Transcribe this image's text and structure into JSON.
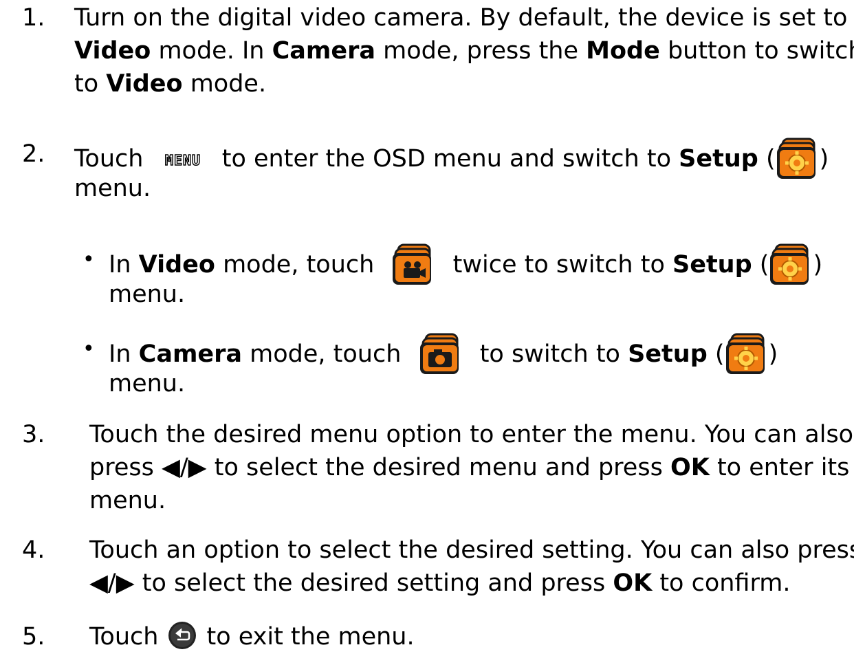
{
  "steps": [
    {
      "number": "1.",
      "lines": [
        [
          "Turn on the digital video camera. By default, the device is set to"
        ],
        [
          "Video",
          " mode. In ",
          "Camera",
          " mode, press the ",
          "Mode",
          " button to switch"
        ],
        [
          "to ",
          "Video",
          " mode."
        ]
      ]
    },
    {
      "number": "2.",
      "touch": "Touch",
      "after_menu": "to enter the OSD menu and switch to",
      "setup": "Setup",
      "open_paren": "(",
      "close_paren": ")",
      "menu": "menu."
    },
    {
      "number": "3.",
      "line1": "Touch the desired menu option to enter the menu. You can also",
      "line2_a": "press ",
      "arrows": "◀/▶",
      "line2_b": " to select the desired menu and press ",
      "ok": "OK",
      "line2_c": " to enter its",
      "line3": "menu."
    },
    {
      "number": "4.",
      "line1": "Touch an option to select the desired setting. You can also press",
      "arrows": "◀/▶",
      "line2_b": " to select the desired setting and press ",
      "ok": "OK",
      "line2_c": " to confirm."
    },
    {
      "number": "5.",
      "touch": "Touch",
      "rest": "to exit the menu."
    }
  ],
  "bullets": [
    {
      "dot": "•",
      "in": "In ",
      "mode": "Video",
      "mid": " mode, touch",
      "after_icon": "twice to switch to",
      "setup": "Setup",
      "open_paren": "(",
      "close_paren": ")",
      "menu": "menu."
    },
    {
      "dot": "•",
      "in": "In ",
      "mode": "Camera",
      "mid": " mode, touch",
      "after_icon": "to switch to",
      "setup": "Setup",
      "open_paren": "(",
      "close_paren": ")",
      "menu": "menu."
    }
  ],
  "icons": {
    "menu_icon_text": "MENU",
    "menu_icon": "menu-icon",
    "setup_icon": "setup-gear-icon",
    "video_icon": "video-camera-icon",
    "camera_icon": "camera-icon",
    "back_icon": "back-return-icon",
    "accent": "#f07c12",
    "dark": "#1a1a1a"
  }
}
